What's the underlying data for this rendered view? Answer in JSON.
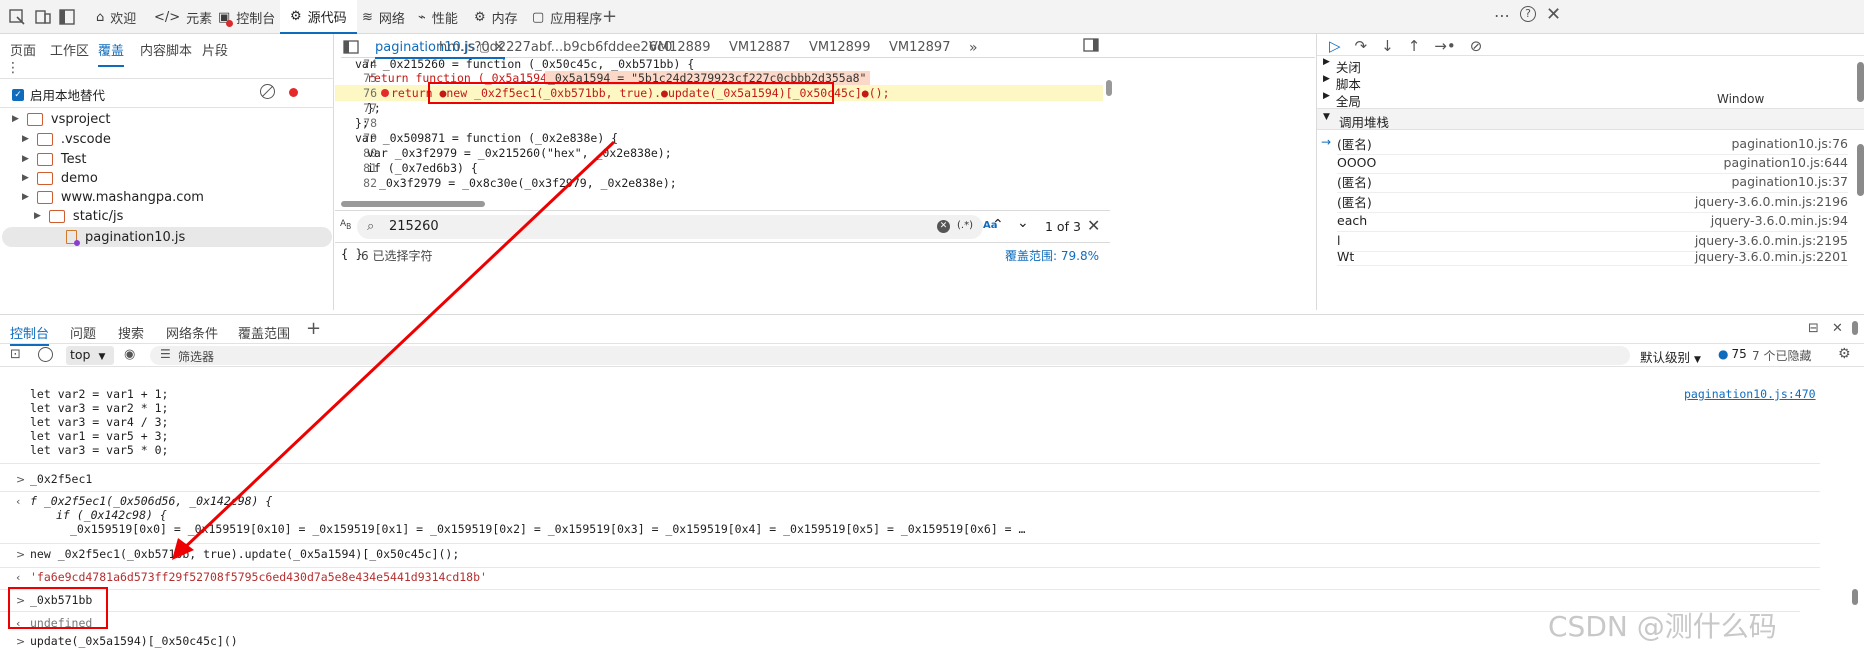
{
  "top_tabs": {
    "welcome": "欢迎",
    "elements": "元素",
    "console": "控制台",
    "sources": "源代码",
    "network": "网络",
    "performance": "性能",
    "memory": "内存",
    "application": "应用程序"
  },
  "left": {
    "tabs": [
      "页面",
      "工作区",
      "覆盖",
      "内容脚本",
      "片段"
    ],
    "override_label": "启用本地替代",
    "tree": [
      "vsproject",
      ".vscode",
      "Test",
      "demo",
      "www.mashangpa.com",
      "static/js",
      "pagination10.js"
    ]
  },
  "editor": {
    "tabs": [
      "pagination10.js",
      "hm.js?0d2227abf...b9cb6fddee26c0",
      "VM12889",
      "VM12887",
      "VM12899",
      "VM12897"
    ],
    "line_numbers": [
      "74",
      "75",
      "76",
      "77",
      "78",
      "79",
      "80",
      "81",
      "82"
    ],
    "code": {
      "l74": "var _0x215260 = function (_0x50c45c, _0xb571bb) {",
      "l75a": "return function (_0x5a1594) {",
      "l75b": "_0x5a1594 = \"5b1c24d2379923cf227c0cbbb2d355a8\"",
      "l76": "return ●new _0x2f5ec1(_0xb571bb, true).●update(_0x5a1594)[_0x50c45c]●();",
      "l77": "};",
      "l78": "};",
      "l79": "var _0x509871 = function (_0x2e838e) {",
      "l80": "var _0x3f2979 = _0x215260(\"hex\", _0x2e838e);",
      "l81": "if (_0x7ed6b3) {",
      "l82": "_0x3f2979 = _0x8c30e(_0x3f2979, _0x2e838e);"
    },
    "search_value": "215260",
    "search_flags": [
      "(.*)",
      "Aa"
    ],
    "match_count": "1 of 3",
    "status_left": "{ }",
    "status_selected": "6 已选择字符",
    "coverage": "覆盖范围: 79.8%"
  },
  "right": {
    "scope": [
      "关闭",
      "脚本",
      "全局"
    ],
    "global_value": "Window",
    "callstack_title": "调用堆栈",
    "callstack": [
      {
        "name": "(匿名)",
        "loc": "pagination10.js:76"
      },
      {
        "name": "OOOO",
        "loc": "pagination10.js:644"
      },
      {
        "name": "(匿名)",
        "loc": "pagination10.js:37"
      },
      {
        "name": "(匿名)",
        "loc": "jquery-3.6.0.min.js:2196"
      },
      {
        "name": "each",
        "loc": "jquery-3.6.0.min.js:94"
      },
      {
        "name": "l",
        "loc": "jquery-3.6.0.min.js:2195"
      },
      {
        "name": "Wt",
        "loc": "jquery-3.6.0.min.js:2201"
      }
    ]
  },
  "drawer": {
    "tabs": [
      "控制台",
      "问题",
      "搜索",
      "网络条件",
      "覆盖范围"
    ],
    "context": "top",
    "filter_placeholder": "筛选器",
    "level": "默认级别",
    "msg_count": "75",
    "hidden_count": "7 个已隐藏",
    "log_source": "pagination10.js:470",
    "lines": [
      "let var2 = var1 + 1;",
      "let var3 = var2 * 1;",
      "let var3 = var4 / 3;",
      "let var1 = var5 + 3;",
      "let var3 = var5 * 0;"
    ],
    "cmd1": "_0x2f5ec1",
    "res1a": "f _0x2f5ec1(_0x506d56, _0x142c98) {",
    "res1b": "if (_0x142c98) {",
    "res1c": "_0x159519[0x0] = _0x159519[0x10] = _0x159519[0x1] = _0x159519[0x2] = _0x159519[0x3] = _0x159519[0x4] = _0x159519[0x5] = _0x159519[0x6] = …",
    "cmd2": "new _0x2f5ec1(_0xb571bb, true).update(_0x5a1594)[_0x50c45c]();",
    "res2": "'fa6e9cd4781a6d573ff29f52708f5795c6ed430d7a5e8e434e5441d9314cd18b'",
    "cmd3": "_0xb571bb",
    "res3": "undefined",
    "cmd4": "update(_0x5a1594)[_0x50c45c]()"
  },
  "watermark": "CSDN @测什么码"
}
